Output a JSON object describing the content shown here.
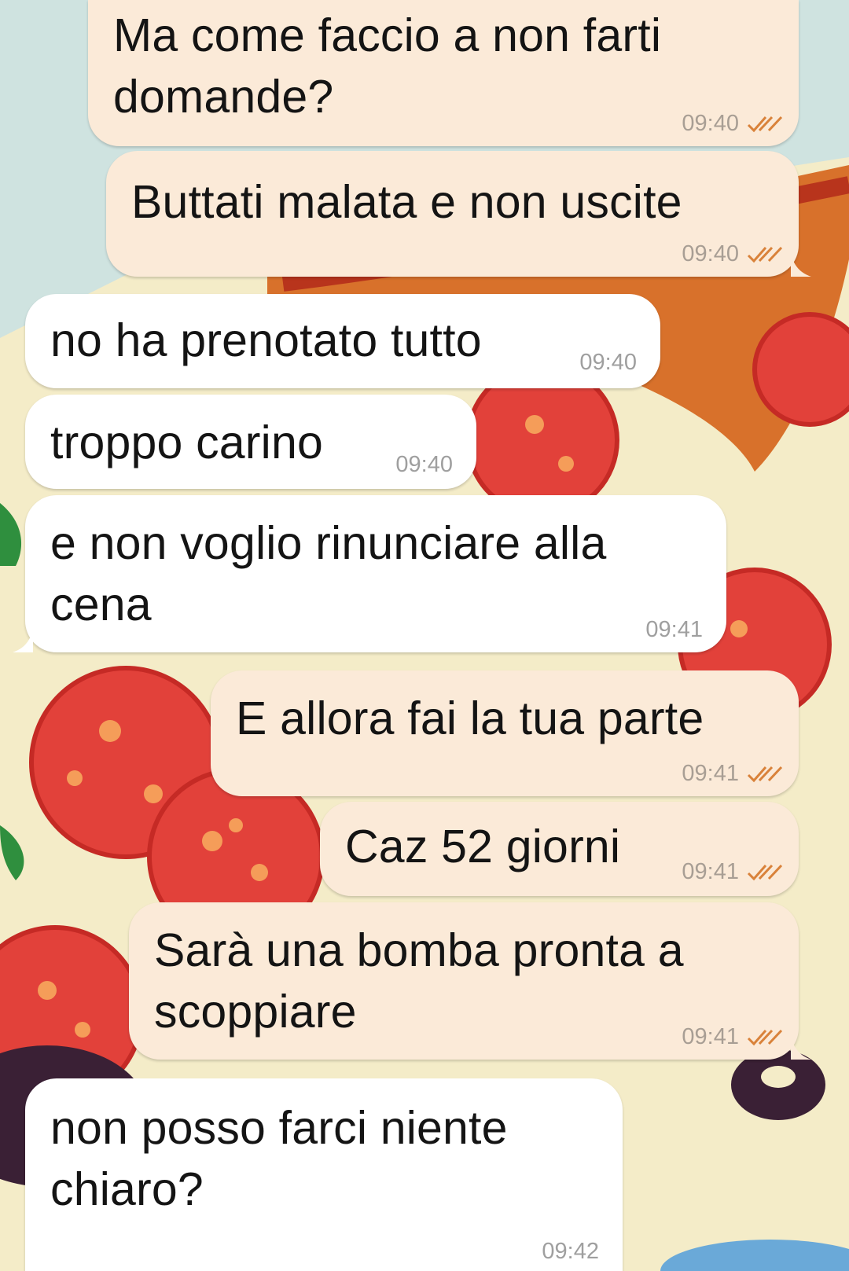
{
  "chat": {
    "messages": [
      {
        "direction": "outgoing",
        "text_lines": [
          "Ma come faccio a non farti",
          "domande?"
        ],
        "time": "09:40",
        "status": "read-double-check"
      },
      {
        "direction": "outgoing",
        "text_lines": [
          "Buttati malata e non uscite"
        ],
        "time": "09:40",
        "status": "read-double-check"
      },
      {
        "direction": "incoming",
        "text_lines": [
          "no ha prenotato tutto"
        ],
        "time": "09:40"
      },
      {
        "direction": "incoming",
        "text_lines": [
          "troppo carino"
        ],
        "time": "09:40"
      },
      {
        "direction": "incoming",
        "text_lines": [
          "e non voglio rinunciare alla",
          "cena"
        ],
        "time": "09:41"
      },
      {
        "direction": "outgoing",
        "text_lines": [
          "E allora fai la tua parte"
        ],
        "time": "09:41",
        "status": "read-double-check"
      },
      {
        "direction": "outgoing",
        "text_lines": [
          "Caz 52 giorni"
        ],
        "time": "09:41",
        "status": "read-double-check"
      },
      {
        "direction": "outgoing",
        "text_lines": [
          "Sarà una bomba pronta a",
          "scoppiare"
        ],
        "time": "09:41",
        "status": "read-double-check"
      },
      {
        "direction": "incoming",
        "text_lines": [
          "non posso farci niente",
          "chiaro?"
        ],
        "time": "09:42"
      }
    ]
  },
  "icons": {
    "read_receipt": "double-check-icon"
  },
  "colors": {
    "outgoing_bubble": "#fbead8",
    "incoming_bubble": "#ffffff",
    "read_tick": "#d9823a",
    "wallpaper_base": "#cfe3e0",
    "pizza_cheese": "#f4ecc8",
    "pizza_crust": "#d8712b",
    "tomato": "#e2413a"
  },
  "wallpaper": {
    "theme": "pizza"
  }
}
